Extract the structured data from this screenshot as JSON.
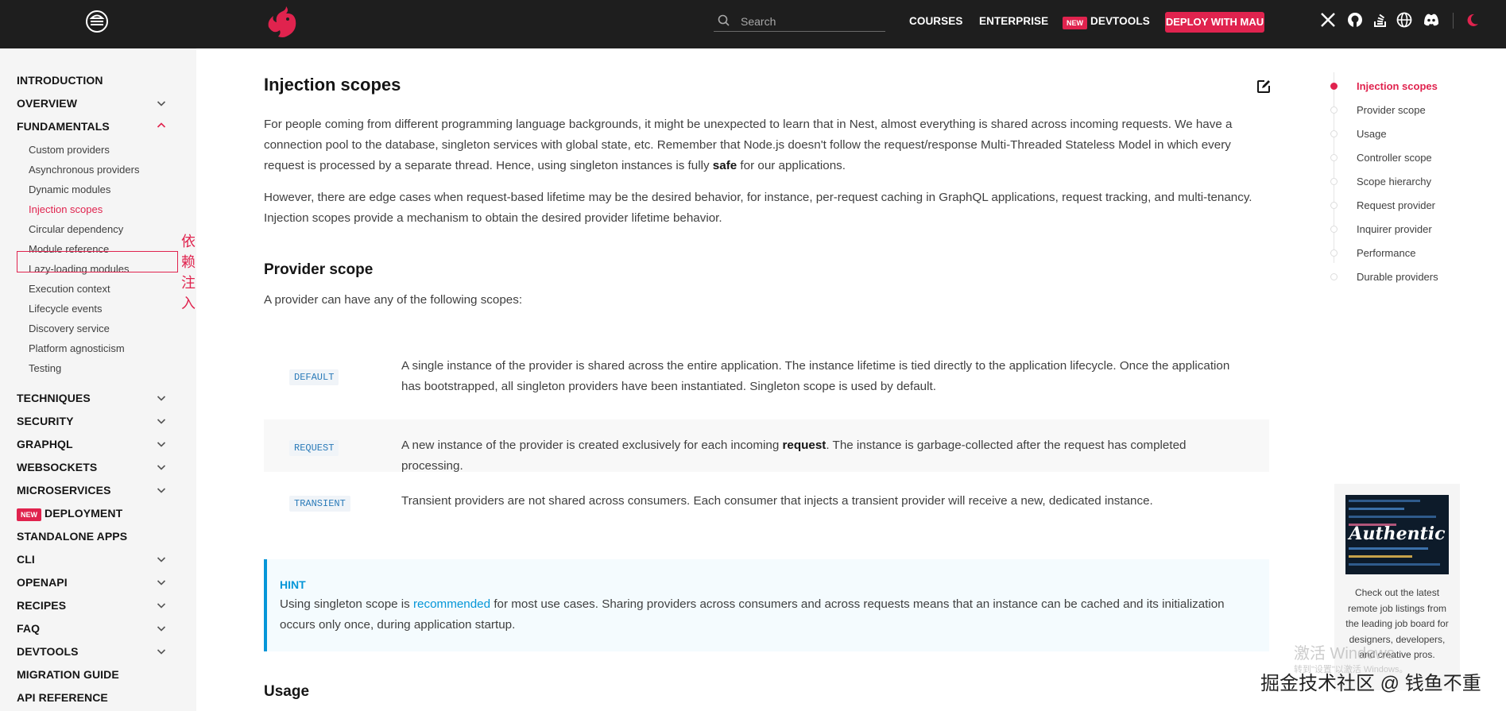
{
  "header": {
    "search_placeholder": "Search",
    "nav": [
      "COURSES",
      "ENTERPRISE",
      "DEVTOOLS"
    ],
    "new_badge": "NEW",
    "deploy_label": "DEPLOY WITH MAU",
    "icons": [
      "menu-icon",
      "nestjs-logo",
      "x-icon",
      "github-icon",
      "stackoverflow-icon",
      "globe-icon",
      "discord-icon",
      "theme-toggle-icon"
    ]
  },
  "sidebar": {
    "items": [
      {
        "label": "INTRODUCTION",
        "expandable": false
      },
      {
        "label": "OVERVIEW",
        "expandable": true
      },
      {
        "label": "FUNDAMENTALS",
        "expandable": true,
        "expanded": true
      }
    ],
    "sub_items": [
      "Custom providers",
      "Asynchronous providers",
      "Dynamic modules",
      "Injection scopes",
      "Circular dependency",
      "Module reference",
      "Lazy-loading modules",
      "Execution context",
      "Lifecycle events",
      "Discovery service",
      "Platform agnosticism",
      "Testing"
    ],
    "active_sub": "Injection scopes",
    "more_items": [
      "TECHNIQUES",
      "SECURITY",
      "GRAPHQL",
      "WEBSOCKETS",
      "MICROSERVICES",
      "DEPLOYMENT",
      "STANDALONE APPS",
      "CLI",
      "OPENAPI",
      "RECIPES",
      "FAQ",
      "DEVTOOLS",
      "MIGRATION GUIDE",
      "API REFERENCE"
    ],
    "new_badge": "NEW",
    "annotation": "依赖注入"
  },
  "main": {
    "title": "Injection scopes",
    "intro_p1_a": "For people coming from different programming language backgrounds, it might be unexpected to learn that in Nest, almost everything is shared across incoming requests. We have a connection pool to the database, singleton services with global state, etc. Remember that Node.js doesn't follow the request/response Multi-Threaded Stateless Model in which every request is processed by a separate thread. Hence, using singleton instances is fully ",
    "intro_p1_bold": "safe",
    "intro_p1_b": " for our applications.",
    "intro_p2": "However, there are edge cases when request-based lifetime may be the desired behavior, for instance, per-request caching in GraphQL applications, request tracking, and multi-tenancy. Injection scopes provide a mechanism to obtain the desired provider lifetime behavior.",
    "provider_scope_heading": "Provider scope",
    "provider_scope_intro": "A provider can have any of the following scopes:",
    "scopes": [
      {
        "code": "DEFAULT",
        "desc": "A single instance of the provider is shared across the entire application. The instance lifetime is tied directly to the application lifecycle. Once the application has bootstrapped, all singleton providers have been instantiated. Singleton scope is used by default."
      },
      {
        "code": "REQUEST",
        "desc_a": "A new instance of the provider is created exclusively for each incoming ",
        "desc_bold": "request",
        "desc_b": ". The instance is garbage-collected after the request has completed processing."
      },
      {
        "code": "TRANSIENT",
        "desc": "Transient providers are not shared across consumers. Each consumer that injects a transient provider will receive a new, dedicated instance."
      }
    ],
    "hint": {
      "title": "HINT",
      "body_a": "Using singleton scope is ",
      "link": "recommended",
      "body_b": " for most use cases. Sharing providers across consumers and across requests means that an instance can be cached and its initialization occurs only once, during application startup."
    },
    "usage_heading": "Usage"
  },
  "toc": {
    "items": [
      "Injection scopes",
      "Provider scope",
      "Usage",
      "Controller scope",
      "Scope hierarchy",
      "Request provider",
      "Inquirer provider",
      "Performance",
      "Durable providers"
    ],
    "active": "Injection scopes"
  },
  "ad": {
    "image_word": "Authentic",
    "text": "Check out the latest remote job listings from the leading job board for designers, developers, and creative pros."
  },
  "watermark": {
    "activate": "激活 Windows",
    "activate_sub": "转到\"设置\"以激活 Windows。",
    "community": "掘金技术社区 @ 钱鱼不重"
  },
  "colors": {
    "brand": "#e0234e",
    "link": "#0596d8",
    "header_bg": "#1e1e1e"
  }
}
